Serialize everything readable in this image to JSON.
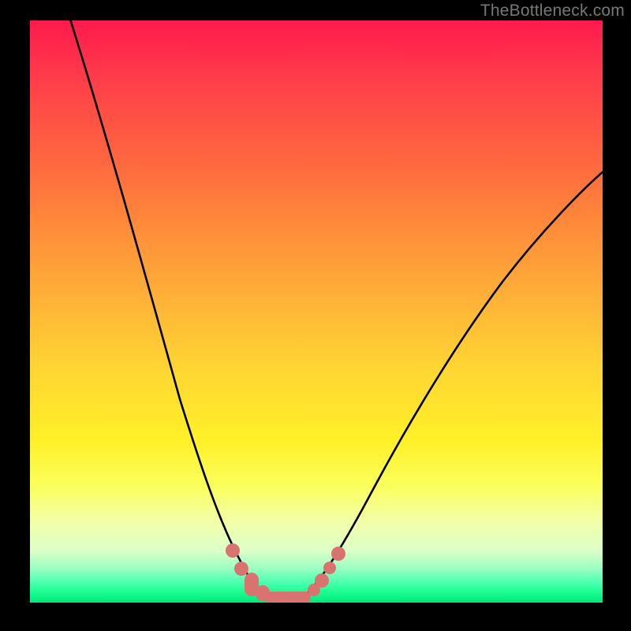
{
  "watermark": "TheBottleneck.com",
  "colors": {
    "frame": "#000000",
    "curve": "#000000",
    "marker": "#d9736f"
  },
  "chart_data": {
    "type": "line",
    "title": "",
    "xlabel": "",
    "ylabel": "",
    "xlim": [
      0,
      100
    ],
    "ylim": [
      0,
      100
    ],
    "x": [
      0,
      4,
      8,
      12,
      16,
      20,
      24,
      28,
      32,
      34,
      36,
      38,
      40,
      42,
      44,
      46,
      50,
      54,
      58,
      62,
      66,
      70,
      76,
      82,
      88,
      94,
      100
    ],
    "values": [
      104,
      92,
      80,
      68,
      57,
      46,
      36,
      27,
      18,
      13,
      9,
      5,
      2.5,
      1.2,
      1,
      1.2,
      3,
      7,
      13,
      20,
      27,
      34,
      44,
      53,
      61,
      68,
      74
    ],
    "markers_x": [
      31.5,
      33.5,
      35,
      37,
      39,
      41,
      43,
      45,
      47.0,
      48.6,
      50.2,
      51.8
    ],
    "markers_y": [
      19,
      13.5,
      9.8,
      6,
      3.5,
      2,
      1.5,
      2,
      3.5,
      5.5,
      8,
      11
    ],
    "note": "Values are relative percentages read off the vertical gradient; 0 = bottom (green), 100 = top (red). Curve depicts a bottleneck dip near x≈44."
  }
}
